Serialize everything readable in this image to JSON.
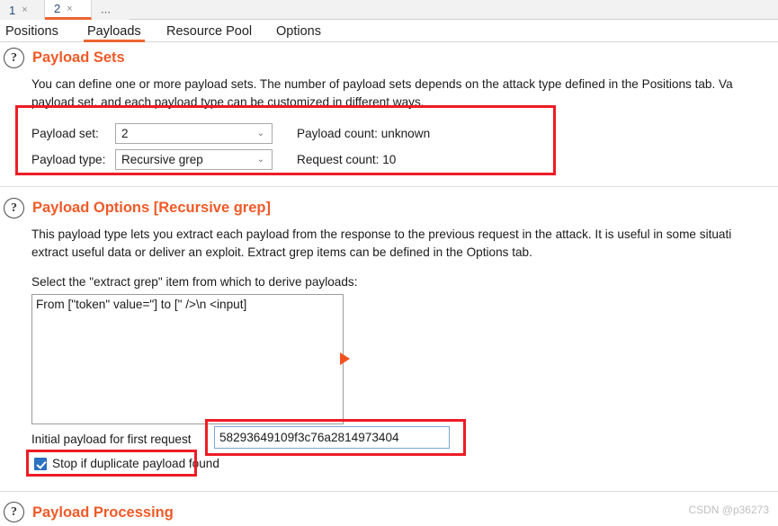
{
  "window": {
    "numbered_tabs": [
      {
        "label": "1",
        "close": "×",
        "active": false
      },
      {
        "label": "2",
        "close": "×",
        "active": true
      }
    ],
    "overflow_label": "⋯"
  },
  "main_tabs": [
    {
      "label": "Positions",
      "active": false
    },
    {
      "label": "Payloads",
      "active": true
    },
    {
      "label": "Resource Pool",
      "active": false
    },
    {
      "label": "Options",
      "active": false
    }
  ],
  "payload_sets": {
    "help_icon": "?",
    "heading": "Payload Sets",
    "description_line1": "You can define one or more payload sets. The number of payload sets depends on the attack type defined in the Positions tab. Va",
    "description_line2": "payload set, and each payload type can be customized in different ways.",
    "payload_set_label": "Payload set:",
    "payload_set_value": "2",
    "payload_type_label": "Payload type:",
    "payload_type_value": "Recursive grep",
    "payload_count": "Payload count: unknown",
    "request_count": "Request count: 10",
    "chevron": "⌄"
  },
  "payload_options": {
    "help_icon": "?",
    "heading": "Payload Options [Recursive grep]",
    "description_line1": "This payload type lets you extract each payload from the response to the previous request in the attack. It is useful in some situati",
    "description_line2": "extract useful data or deliver an exploit. Extract grep items can be defined in the Options tab.",
    "select_label": "Select the \"extract grep\" item from which to derive payloads:",
    "grep_items": [
      "From [\"token\" value=\"] to [\" />\\n   <input]"
    ],
    "initial_payload_label": "Initial payload for first request",
    "initial_payload_value": "58293649109f3c76a2814973404",
    "stop_duplicate_label": "Stop if duplicate payload found",
    "stop_duplicate_checked": true
  },
  "payload_processing": {
    "help_icon": "?",
    "heading": "Payload Processing"
  },
  "watermark": "CSDN @p36273",
  "colors": {
    "accent_orange": "#f05a28",
    "tab_underline": "#ec6631",
    "annotation_red": "#ee1c25",
    "checkbox_blue": "#2a72c4",
    "arrow_orange": "#f4511e"
  }
}
